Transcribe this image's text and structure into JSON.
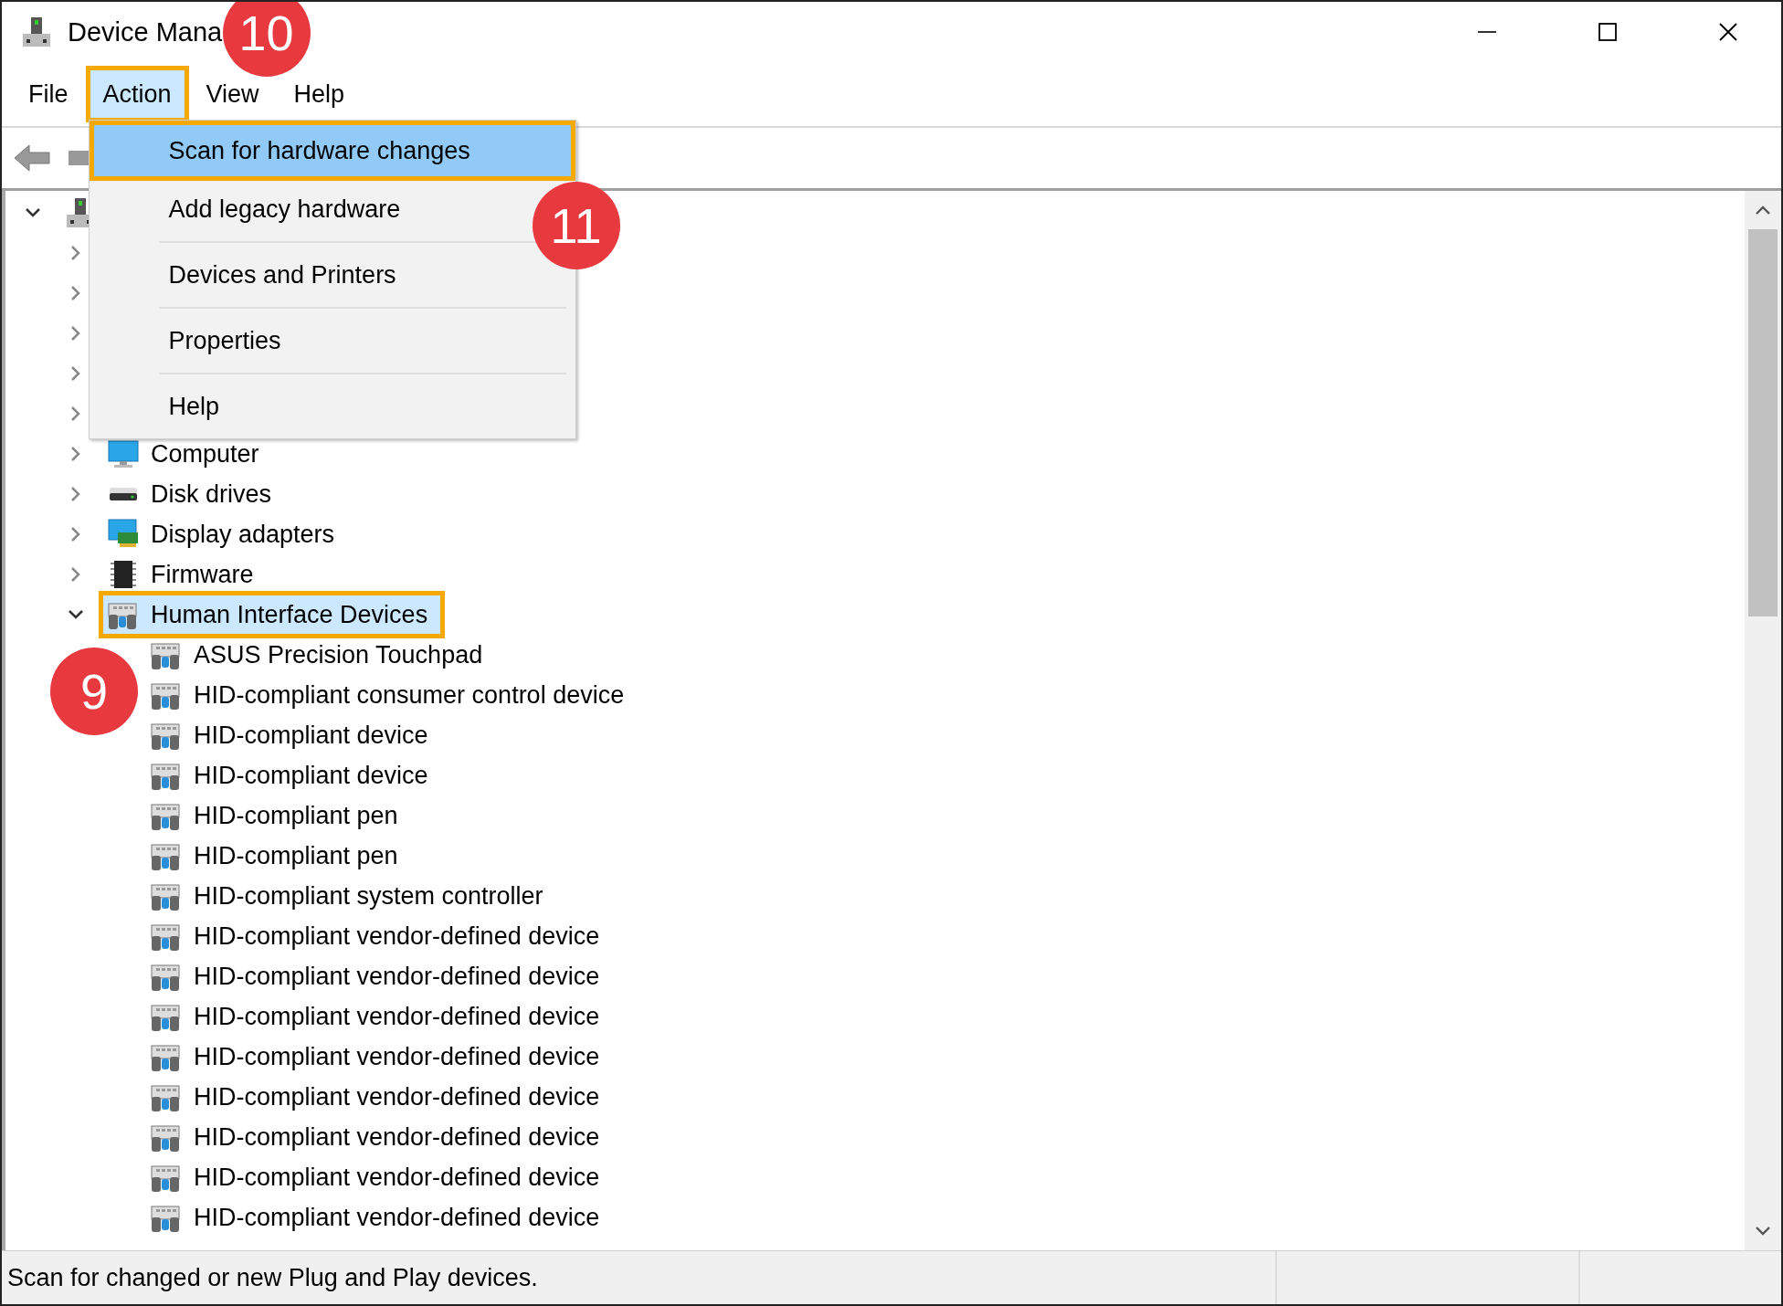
{
  "window": {
    "title": "Device Mana"
  },
  "menu_bar": [
    {
      "label": "File",
      "selected": false,
      "highlighted": false
    },
    {
      "label": "Action",
      "selected": true,
      "highlighted": true,
      "callout": "10"
    },
    {
      "label": "View",
      "selected": false,
      "highlighted": false
    },
    {
      "label": "Help",
      "selected": false,
      "highlighted": false
    }
  ],
  "action_menu": {
    "items": [
      {
        "kind": "item",
        "label": "Scan for hardware changes",
        "selected": true,
        "highlighted": true,
        "callout": "11"
      },
      {
        "kind": "item",
        "label": "Add legacy hardware",
        "selected": false,
        "highlighted": false
      },
      {
        "kind": "separator"
      },
      {
        "kind": "item",
        "label": "Devices and Printers",
        "selected": false,
        "highlighted": false
      },
      {
        "kind": "separator"
      },
      {
        "kind": "item",
        "label": "Properties",
        "selected": false,
        "highlighted": false
      },
      {
        "kind": "separator"
      },
      {
        "kind": "item",
        "label": "Help",
        "selected": false,
        "highlighted": false
      }
    ]
  },
  "tree": {
    "kind": "root",
    "expanded": true,
    "selected": false,
    "highlighted": false,
    "children": [
      {
        "kind": "covered",
        "expanded": false
      },
      {
        "kind": "covered",
        "expanded": false
      },
      {
        "kind": "covered",
        "expanded": false
      },
      {
        "kind": "covered",
        "expanded": false
      },
      {
        "kind": "covered",
        "expanded": false
      },
      {
        "kind": "computer",
        "label": "Computer",
        "expanded": false,
        "selected": false,
        "highlighted": false
      },
      {
        "kind": "disk",
        "label": "Disk drives",
        "expanded": false,
        "selected": false,
        "highlighted": false
      },
      {
        "kind": "display",
        "label": "Display adapters",
        "expanded": false,
        "selected": false,
        "highlighted": false
      },
      {
        "kind": "firmware",
        "label": "Firmware",
        "expanded": false,
        "selected": false,
        "highlighted": false
      },
      {
        "kind": "hid",
        "label": "Human Interface Devices",
        "expanded": true,
        "selected": true,
        "highlighted": true,
        "callout": "9",
        "children": [
          {
            "kind": "hid",
            "label": "ASUS Precision Touchpad",
            "selected": false,
            "highlighted": false
          },
          {
            "kind": "hid",
            "label": "HID-compliant consumer control device",
            "selected": false,
            "highlighted": false
          },
          {
            "kind": "hid",
            "label": "HID-compliant device",
            "selected": false,
            "highlighted": false
          },
          {
            "kind": "hid",
            "label": "HID-compliant device",
            "selected": false,
            "highlighted": false
          },
          {
            "kind": "hid",
            "label": "HID-compliant pen",
            "selected": false,
            "highlighted": false
          },
          {
            "kind": "hid",
            "label": "HID-compliant pen",
            "selected": false,
            "highlighted": false
          },
          {
            "kind": "hid",
            "label": "HID-compliant system controller",
            "selected": false,
            "highlighted": false
          },
          {
            "kind": "hid",
            "label": "HID-compliant vendor-defined device",
            "selected": false,
            "highlighted": false
          },
          {
            "kind": "hid",
            "label": "HID-compliant vendor-defined device",
            "selected": false,
            "highlighted": false
          },
          {
            "kind": "hid",
            "label": "HID-compliant vendor-defined device",
            "selected": false,
            "highlighted": false
          },
          {
            "kind": "hid",
            "label": "HID-compliant vendor-defined device",
            "selected": false,
            "highlighted": false
          },
          {
            "kind": "hid",
            "label": "HID-compliant vendor-defined device",
            "selected": false,
            "highlighted": false
          },
          {
            "kind": "hid",
            "label": "HID-compliant vendor-defined device",
            "selected": false,
            "highlighted": false
          },
          {
            "kind": "hid",
            "label": "HID-compliant vendor-defined device",
            "selected": false,
            "highlighted": false
          },
          {
            "kind": "hid",
            "label": "HID-compliant vendor-defined device",
            "selected": false,
            "highlighted": false
          }
        ]
      }
    ]
  },
  "status_bar": {
    "text": "Scan for changed or new Plug and Play devices."
  }
}
